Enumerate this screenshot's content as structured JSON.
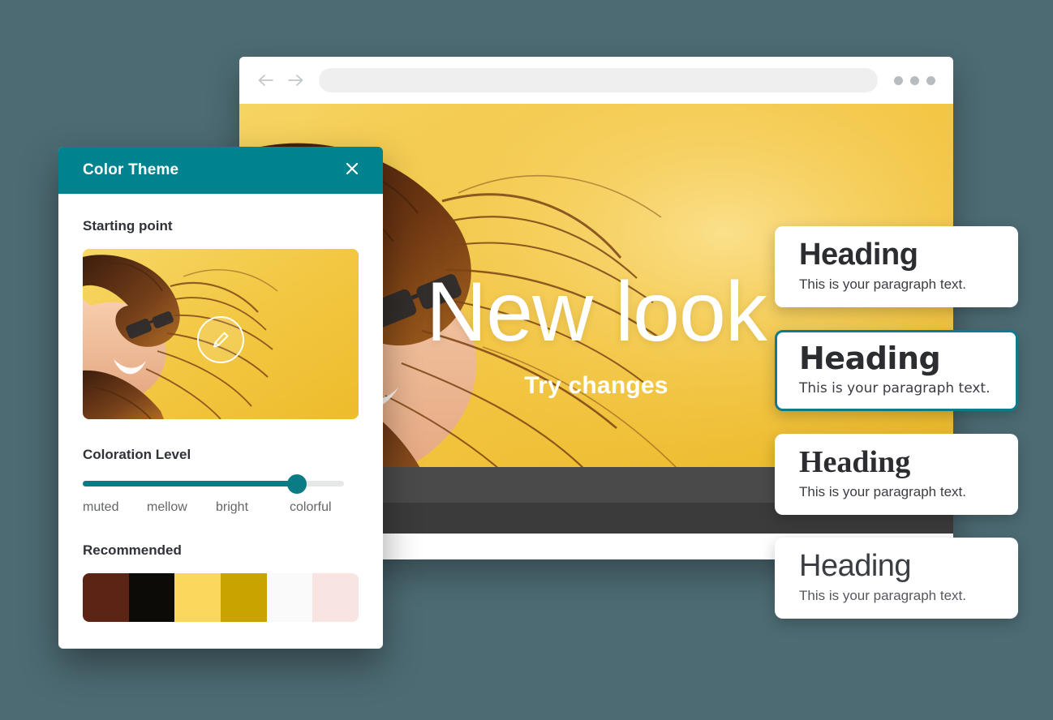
{
  "background_color": "#4D6B73",
  "browser": {
    "back_icon": "arrow-left-icon",
    "forward_icon": "arrow-right-icon",
    "address_value": "",
    "address_placeholder": "",
    "menu_icon": "three-dots-icon"
  },
  "hero": {
    "title": "New look",
    "subtitle": "Try changes",
    "background_color": "#F3C244",
    "footer_color": "#4A4A4A"
  },
  "cards": [
    {
      "heading": "Heading",
      "paragraph": "This is your paragraph text.",
      "style": "style-geo",
      "selected": false
    },
    {
      "heading": "Heading",
      "paragraph": "This is your paragraph text.",
      "style": "style-round",
      "selected": true
    },
    {
      "heading": "Heading",
      "paragraph": "This is your paragraph text.",
      "style": "style-serif",
      "selected": false
    },
    {
      "heading": "Heading",
      "paragraph": "This is your paragraph text.",
      "style": "style-light",
      "selected": false
    }
  ],
  "panel": {
    "title": "Color Theme",
    "close_icon": "close-icon",
    "accent_color": "#00838E",
    "starting_point_label": "Starting point",
    "edit_icon": "pencil-icon",
    "coloration_label": "Coloration Level",
    "slider_value": 82,
    "slider_ticks": [
      "muted",
      "mellow",
      "bright",
      "colorful"
    ],
    "recommended_label": "Recommended",
    "swatches": [
      {
        "name": "swatch-dark-brown",
        "color": "#5C2415"
      },
      {
        "name": "swatch-black",
        "color": "#0C0B08"
      },
      {
        "name": "swatch-light-yellow",
        "color": "#FBD75B"
      },
      {
        "name": "swatch-gold",
        "color": "#C9A400"
      },
      {
        "name": "swatch-white",
        "color": "#FAFAFA"
      },
      {
        "name": "swatch-pale-pink",
        "color": "#F8E5E2"
      }
    ]
  }
}
